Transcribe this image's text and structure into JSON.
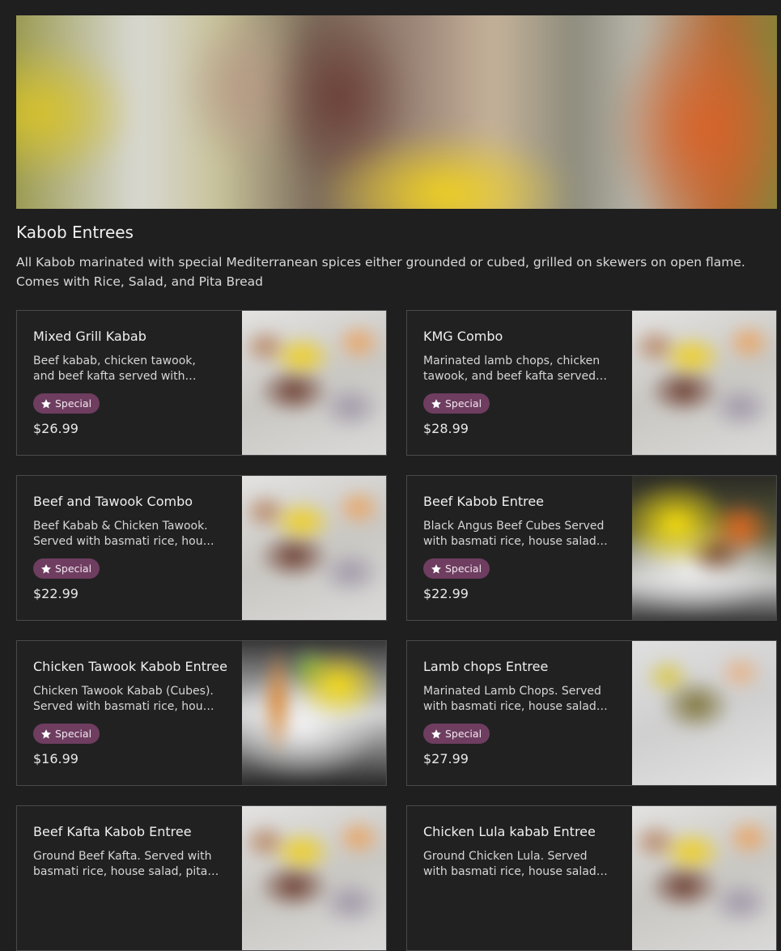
{
  "section": {
    "title": "Kabob Entrees",
    "description": "All Kabob marinated with special Mediterranean spices either grounded or cubed, grilled on skewers on open flame. Comes with Rice, Salad, and Pita Bread"
  },
  "items": [
    {
      "name": "Mixed Grill Kabab",
      "description": "Beef kabab, chicken tawook, and beef kafta served with basmati rice, house salad, pita bread.",
      "badge": "Special",
      "price": "$26.99"
    },
    {
      "name": "KMG Combo",
      "description": "Marinated lamb chops, chicken tawook, and beef kafta served with basmati rice, house salad, pita bread.",
      "badge": "Special",
      "price": "$28.99"
    },
    {
      "name": "Beef and Tawook Combo",
      "description": "Beef Kabab & Chicken Tawook. Served with basmati rice, house salad, pita bread.",
      "badge": "Special",
      "price": "$22.99"
    },
    {
      "name": "Beef Kabob Entree",
      "description": "Black Angus Beef Cubes Served with basmati rice, house salad, pita bread.",
      "badge": "Special",
      "price": "$22.99"
    },
    {
      "name": "Chicken Tawook Kabob Entree",
      "description": "Chicken Tawook Kabab (Cubes). Served with basmati rice, house salad, pita bread.",
      "badge": "Special",
      "price": "$16.99"
    },
    {
      "name": "Lamb chops Entree",
      "description": "Marinated Lamb Chops. Served with basmati rice, house salad, pita bread.",
      "badge": "Special",
      "price": "$27.99"
    },
    {
      "name": "Beef Kafta Kabob Entree",
      "description": "Ground Beef Kafta. Served with basmati rice, house salad, pita bread."
    },
    {
      "name": "Chicken Lula kabab Entree",
      "description": "Ground Chicken Lula. Served with basmati rice, house salad, pita bread."
    }
  ],
  "colors": {
    "background": "#1f1f1f",
    "badge": "#6e3d60",
    "card_border": "#4a4a4a"
  }
}
